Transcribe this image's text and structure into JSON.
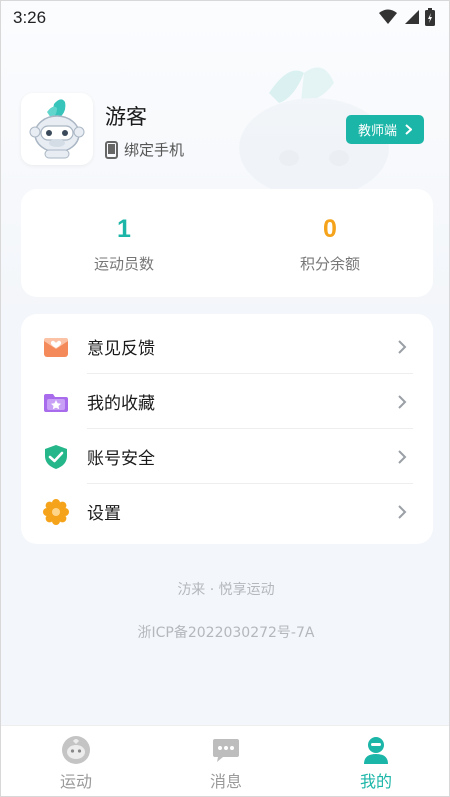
{
  "status_bar": {
    "time": "3:26"
  },
  "profile": {
    "username": "游客",
    "bind_phone_label": "绑定手机",
    "teacher_button_label": "教师端"
  },
  "stats": [
    {
      "value": "1",
      "label": "运动员数",
      "color": "#1cb6a8"
    },
    {
      "value": "0",
      "label": "积分余额",
      "color": "#f5a31a"
    }
  ],
  "menu": [
    {
      "label": "意见反馈",
      "icon": "feedback-envelope-icon"
    },
    {
      "label": "我的收藏",
      "icon": "favorites-folder-icon"
    },
    {
      "label": "账号安全",
      "icon": "shield-check-icon"
    },
    {
      "label": "设置",
      "icon": "settings-gear-icon"
    }
  ],
  "footer": {
    "brand": "汸来 · 悦享运动",
    "icp": "浙ICP备2022030272号-7A"
  },
  "tabs": [
    {
      "label": "运动",
      "icon": "sport-mascot-icon",
      "active": false
    },
    {
      "label": "消息",
      "icon": "message-bubble-icon",
      "active": false
    },
    {
      "label": "我的",
      "icon": "profile-person-icon",
      "active": true
    }
  ],
  "colors": {
    "accent": "#1cb6a8",
    "points": "#f5a31a",
    "feedback": "#f48a5a",
    "favorites": "#a86bec",
    "security": "#25b68a",
    "settings": "#f5a31a"
  }
}
